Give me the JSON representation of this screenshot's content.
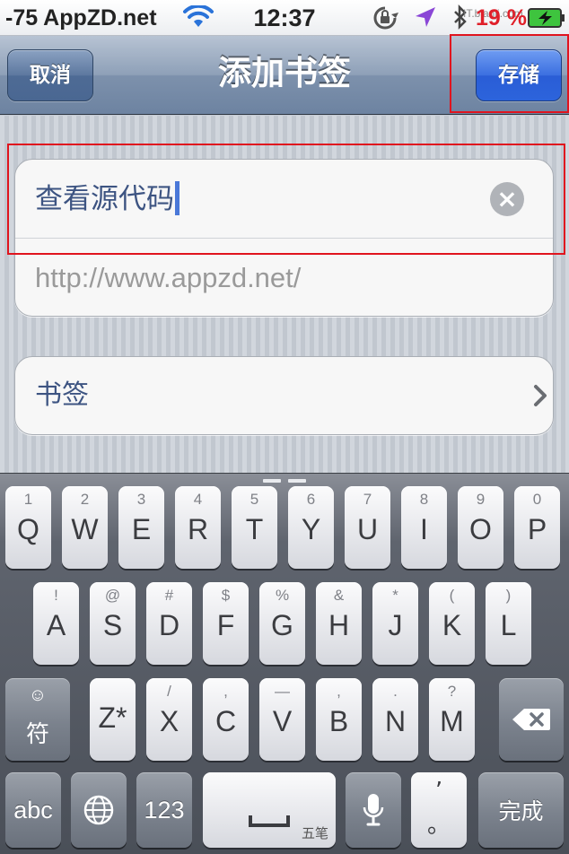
{
  "status_bar": {
    "carrier": "-75 AppZD.net",
    "time": "12:37",
    "battery": "19 %",
    "watermark": "IT.bianji.com"
  },
  "nav": {
    "title": "添加书签",
    "cancel_label": "取消",
    "save_label": "存储"
  },
  "form": {
    "title_value": "查看源代码",
    "url_value": "http://www.appzd.net/",
    "folder_label": "书签"
  },
  "keyboard": {
    "row1": [
      {
        "sub": "1",
        "main": "Q"
      },
      {
        "sub": "2",
        "main": "W"
      },
      {
        "sub": "3",
        "main": "E"
      },
      {
        "sub": "4",
        "main": "R"
      },
      {
        "sub": "5",
        "main": "T"
      },
      {
        "sub": "6",
        "main": "Y"
      },
      {
        "sub": "7",
        "main": "U"
      },
      {
        "sub": "8",
        "main": "I"
      },
      {
        "sub": "9",
        "main": "O"
      },
      {
        "sub": "0",
        "main": "P"
      }
    ],
    "row2": [
      {
        "sub": "!",
        "main": "A"
      },
      {
        "sub": "@",
        "main": "S"
      },
      {
        "sub": "#",
        "main": "D"
      },
      {
        "sub": "$",
        "main": "F"
      },
      {
        "sub": "%",
        "main": "G"
      },
      {
        "sub": "&",
        "main": "H"
      },
      {
        "sub": "*",
        "main": "J"
      },
      {
        "sub": "(",
        "main": "K"
      },
      {
        "sub": ")",
        "main": "L"
      }
    ],
    "row3": [
      {
        "sub": "",
        "main": "Z*"
      },
      {
        "sub": "/",
        "main": "X"
      },
      {
        "sub": ",",
        "main": "C"
      },
      {
        "sub": "—",
        "main": "V"
      },
      {
        "sub": ",",
        "main": "B"
      },
      {
        "sub": ".",
        "main": "N"
      },
      {
        "sub": "?",
        "main": "M"
      }
    ],
    "symbol_label": "符",
    "abc_label": "abc",
    "num_label": "123",
    "space_hint": "五笔",
    "comma_top": "’",
    "period_bottom": "。",
    "done_label": "完成"
  },
  "colors": {
    "save_button": "#2c64dc",
    "battery_text": "#e0202a",
    "annotation_box": "#e0141e"
  }
}
